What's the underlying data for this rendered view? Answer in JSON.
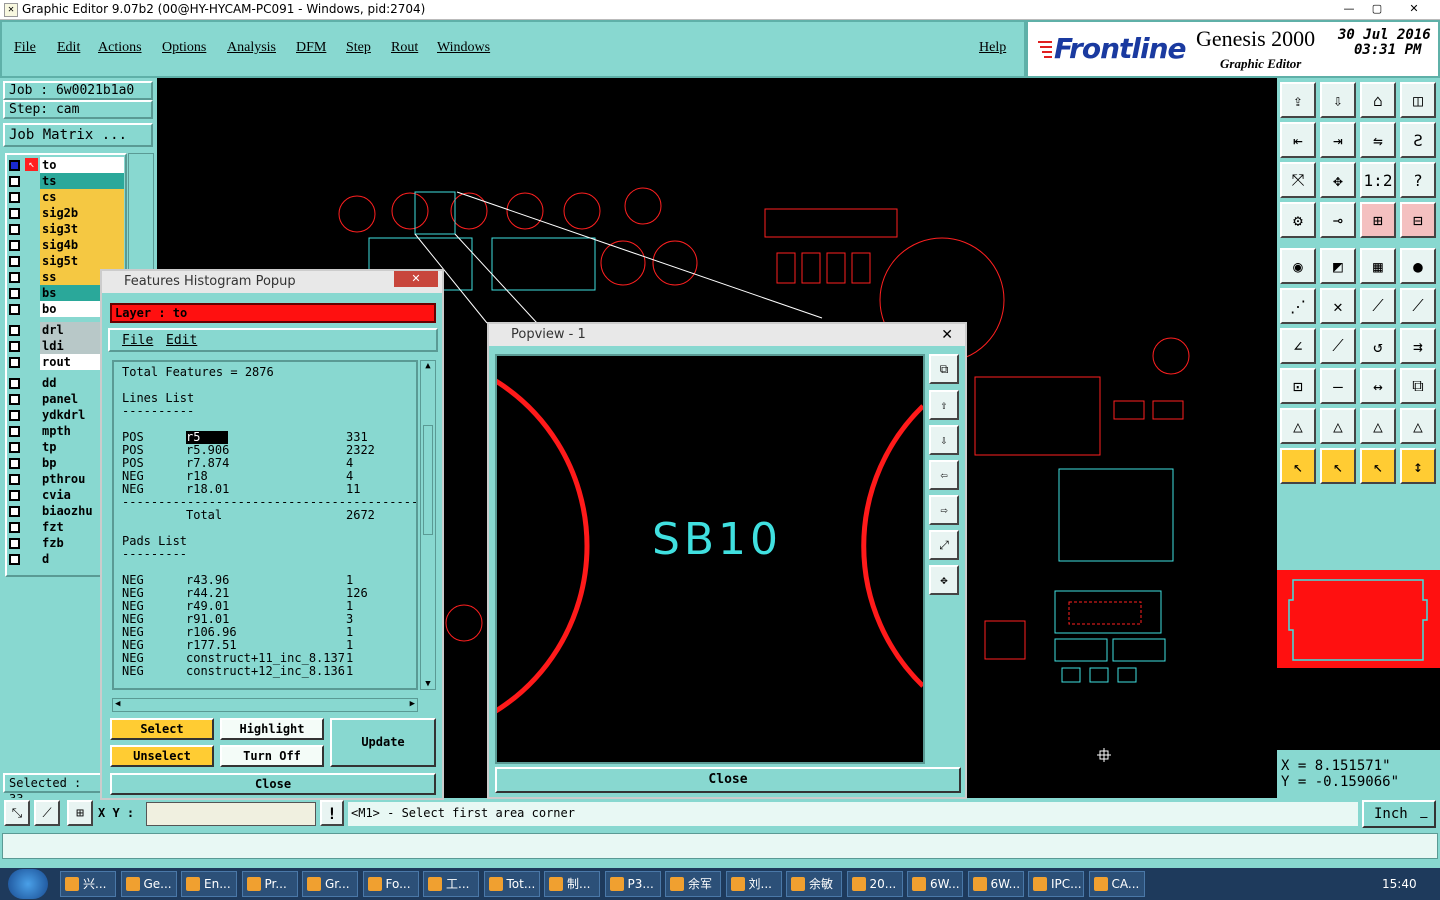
{
  "window": {
    "title": "Graphic Editor 9.07b2 (00@HY-HYCAM-PC091 - Windows, pid:2704)",
    "controls": [
      "—",
      "▢",
      "✕"
    ]
  },
  "menu": {
    "items": [
      {
        "label": "File"
      },
      {
        "label": "Edit"
      },
      {
        "label": "Actions"
      },
      {
        "label": "Options"
      },
      {
        "label": "Analysis"
      },
      {
        "label": "DFM"
      },
      {
        "label": "Step"
      },
      {
        "label": "Rout"
      },
      {
        "label": "Windows"
      }
    ],
    "help": "Help"
  },
  "brand": {
    "logo": "Frontline",
    "product": "Genesis 2000",
    "subtitle": "Graphic Editor",
    "date": "30 Jul 2016",
    "time": "03:31 PM"
  },
  "job": {
    "job": "Job : 6w0021b1a0",
    "step": "Step: cam",
    "matrix_button": "Job Matrix ..."
  },
  "layers": {
    "group1": [
      {
        "name": "to",
        "color": "#ffffff",
        "active": true
      },
      {
        "name": "ts",
        "color": "#2aa89a"
      },
      {
        "name": "cs",
        "color": "#f5c842"
      },
      {
        "name": "sig2b",
        "color": "#f5c842"
      },
      {
        "name": "sig3t",
        "color": "#f5c842"
      },
      {
        "name": "sig4b",
        "color": "#f5c842"
      },
      {
        "name": "sig5t",
        "color": "#f5c842"
      },
      {
        "name": "ss",
        "color": "#f5c842"
      },
      {
        "name": "bs",
        "color": "#2aa89a"
      },
      {
        "name": "bo",
        "color": "#ffffff"
      }
    ],
    "group2": [
      {
        "name": "drl",
        "color": "#b8c8c8"
      },
      {
        "name": "ldi",
        "color": "#b8c8c8"
      },
      {
        "name": "rout",
        "color": "#ffffff"
      }
    ],
    "group3": [
      {
        "name": "dd"
      },
      {
        "name": "panel"
      },
      {
        "name": "ydkdrl"
      },
      {
        "name": "mpth"
      },
      {
        "name": "tp"
      },
      {
        "name": "bp"
      },
      {
        "name": "pthrou"
      },
      {
        "name": "cvia"
      },
      {
        "name": "biaozhu"
      },
      {
        "name": "fzt"
      },
      {
        "name": "fzb"
      },
      {
        "name": "d"
      }
    ]
  },
  "selected": "Selected : 33",
  "histogram": {
    "title": "Features Histogram Popup",
    "layer": "Layer :  to",
    "menu": [
      "File",
      "Edit"
    ],
    "total": "Total Features = 2876",
    "lines_header": "Lines List",
    "lines_rule": "----------",
    "lines": [
      {
        "pol": "POS",
        "sym": "r5",
        "count": "331"
      },
      {
        "pol": "POS",
        "sym": "r5.906",
        "count": "2322"
      },
      {
        "pol": "POS",
        "sym": "r7.874",
        "count": "4"
      },
      {
        "pol": "NEG",
        "sym": "r18",
        "count": "4"
      },
      {
        "pol": "NEG",
        "sym": "r18.01",
        "count": "11"
      }
    ],
    "divider": "------------------------------------------",
    "total_label": "Total",
    "total_value": "2672",
    "pads_header": "Pads List",
    "pads_rule": "---------",
    "pads": [
      {
        "pol": "NEG",
        "sym": "r43.96",
        "count": "1"
      },
      {
        "pol": "NEG",
        "sym": "r44.21",
        "count": "126"
      },
      {
        "pol": "NEG",
        "sym": "r49.01",
        "count": "1"
      },
      {
        "pol": "NEG",
        "sym": "r91.01",
        "count": "3"
      },
      {
        "pol": "NEG",
        "sym": "r106.96",
        "count": "1"
      },
      {
        "pol": "NEG",
        "sym": "r177.51",
        "count": "1"
      },
      {
        "pol": "NEG",
        "sym": "construct+11_inc_8.137",
        "count": "1"
      },
      {
        "pol": "NEG",
        "sym": "construct+12_inc_8.136",
        "count": "1"
      }
    ],
    "buttons": {
      "select": "Select",
      "highlight": "Highlight",
      "unselect": "Unselect",
      "turn_off": "Turn Off",
      "update": "Update",
      "close": "Close"
    }
  },
  "popview": {
    "title": "Popview - 1",
    "label": "SB10",
    "close": "Close"
  },
  "coords": {
    "x": "X = 8.151571\"",
    "y": "Y = -0.159066\""
  },
  "status": {
    "xy_label": "X Y :",
    "message": "<M1> - Select first area corner",
    "units": "Inch"
  },
  "taskbar": {
    "items": [
      "兴...",
      "Ge...",
      "En...",
      "Pr...",
      "Gr...",
      "Fo...",
      "工...",
      "Tot...",
      "制...",
      "P3...",
      "余军",
      "刘...",
      "余敏",
      "20...",
      "6W...",
      "6W...",
      "IPC...",
      "CA..."
    ],
    "clock": "15:40"
  },
  "colors": {
    "panel": "#88d8d0",
    "pcb_red": "#ff2020",
    "pcb_cyan": "#40e0e0"
  }
}
